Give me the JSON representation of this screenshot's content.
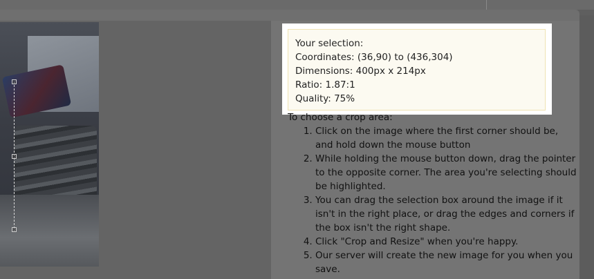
{
  "selection": {
    "heading": "Your selection:",
    "coordinates": "Coordinates: (36,90) to (436,304)",
    "dimensions": "Dimensions: 400px x 214px",
    "ratio": "Ratio: 1.87:1",
    "quality": "Quality: 75%"
  },
  "instructions": {
    "intro": "To choose a crop area:",
    "steps": [
      "Click on the image where the first corner should be, and hold down the mouse button",
      "While holding the mouse button down, drag the pointer to the opposite corner. The area you're selecting should be highlighted.",
      "You can drag the selection box around the image if it isn't in the right place, or drag the edges and corners if the box isn't the right shape.",
      "Click \"Crop and Resize\" when you're happy.",
      "Our server will create the new image for you when you save."
    ]
  }
}
